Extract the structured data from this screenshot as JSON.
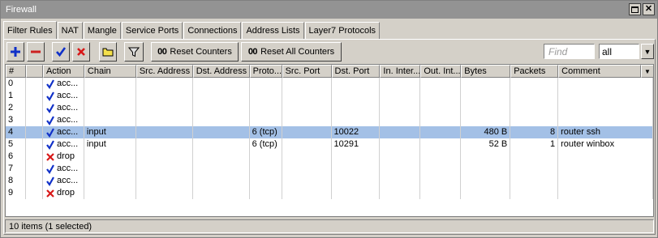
{
  "window": {
    "title": "Firewall"
  },
  "tabs": [
    {
      "label": "Filter Rules",
      "active": true
    },
    {
      "label": "NAT"
    },
    {
      "label": "Mangle"
    },
    {
      "label": "Service Ports"
    },
    {
      "label": "Connections"
    },
    {
      "label": "Address Lists"
    },
    {
      "label": "Layer7 Protocols"
    }
  ],
  "toolbar": {
    "reset_counters": "Reset Counters",
    "reset_all_counters": "Reset All Counters",
    "counter_prefix": "00",
    "find_placeholder": "Find",
    "filter_value": "all",
    "colors": {
      "add": "#1030c8",
      "remove": "#cc2020",
      "enable": "#1030c8",
      "disable": "#d81818"
    }
  },
  "columns": [
    "#",
    "",
    "Action",
    "Chain",
    "Src. Address",
    "Dst. Address",
    "Proto...",
    "Src. Port",
    "Dst. Port",
    "In. Inter...",
    "Out. Int...",
    "Bytes",
    "Packets",
    "Comment"
  ],
  "rows": [
    {
      "num": "0",
      "action": "acc...",
      "action_icon": "accept",
      "chain": "",
      "src": "",
      "dst": "",
      "proto": "",
      "sport": "",
      "dport": "",
      "inif": "",
      "outif": "",
      "bytes": "",
      "packets": "",
      "comment": ""
    },
    {
      "num": "1",
      "action": "acc...",
      "action_icon": "accept",
      "chain": "",
      "src": "",
      "dst": "",
      "proto": "",
      "sport": "",
      "dport": "",
      "inif": "",
      "outif": "",
      "bytes": "",
      "packets": "",
      "comment": ""
    },
    {
      "num": "2",
      "action": "acc...",
      "action_icon": "accept",
      "chain": "",
      "src": "",
      "dst": "",
      "proto": "",
      "sport": "",
      "dport": "",
      "inif": "",
      "outif": "",
      "bytes": "",
      "packets": "",
      "comment": ""
    },
    {
      "num": "3",
      "action": "acc...",
      "action_icon": "accept",
      "chain": "",
      "src": "",
      "dst": "",
      "proto": "",
      "sport": "",
      "dport": "",
      "inif": "",
      "outif": "",
      "bytes": "",
      "packets": "",
      "comment": ""
    },
    {
      "num": "4",
      "action": "acc...",
      "action_icon": "accept",
      "chain": "input",
      "src": "",
      "dst": "",
      "proto": "6 (tcp)",
      "sport": "",
      "dport": "10022",
      "inif": "",
      "outif": "",
      "bytes": "480 B",
      "packets": "8",
      "comment": "router ssh",
      "selected": true
    },
    {
      "num": "5",
      "action": "acc...",
      "action_icon": "accept",
      "chain": "input",
      "src": "",
      "dst": "",
      "proto": "6 (tcp)",
      "sport": "",
      "dport": "10291",
      "inif": "",
      "outif": "",
      "bytes": "52 B",
      "packets": "1",
      "comment": "router winbox"
    },
    {
      "num": "6",
      "action": "drop",
      "action_icon": "drop",
      "chain": "",
      "src": "",
      "dst": "",
      "proto": "",
      "sport": "",
      "dport": "",
      "inif": "",
      "outif": "",
      "bytes": "",
      "packets": "",
      "comment": ""
    },
    {
      "num": "7",
      "action": "acc...",
      "action_icon": "accept",
      "chain": "",
      "src": "",
      "dst": "",
      "proto": "",
      "sport": "",
      "dport": "",
      "inif": "",
      "outif": "",
      "bytes": "",
      "packets": "",
      "comment": ""
    },
    {
      "num": "8",
      "action": "acc...",
      "action_icon": "accept",
      "chain": "",
      "src": "",
      "dst": "",
      "proto": "",
      "sport": "",
      "dport": "",
      "inif": "",
      "outif": "",
      "bytes": "",
      "packets": "",
      "comment": ""
    },
    {
      "num": "9",
      "action": "drop",
      "action_icon": "drop",
      "chain": "",
      "src": "",
      "dst": "",
      "proto": "",
      "sport": "",
      "dport": "",
      "inif": "",
      "outif": "",
      "bytes": "",
      "packets": "",
      "comment": ""
    }
  ],
  "status": {
    "text": "10 items (1 selected)"
  }
}
